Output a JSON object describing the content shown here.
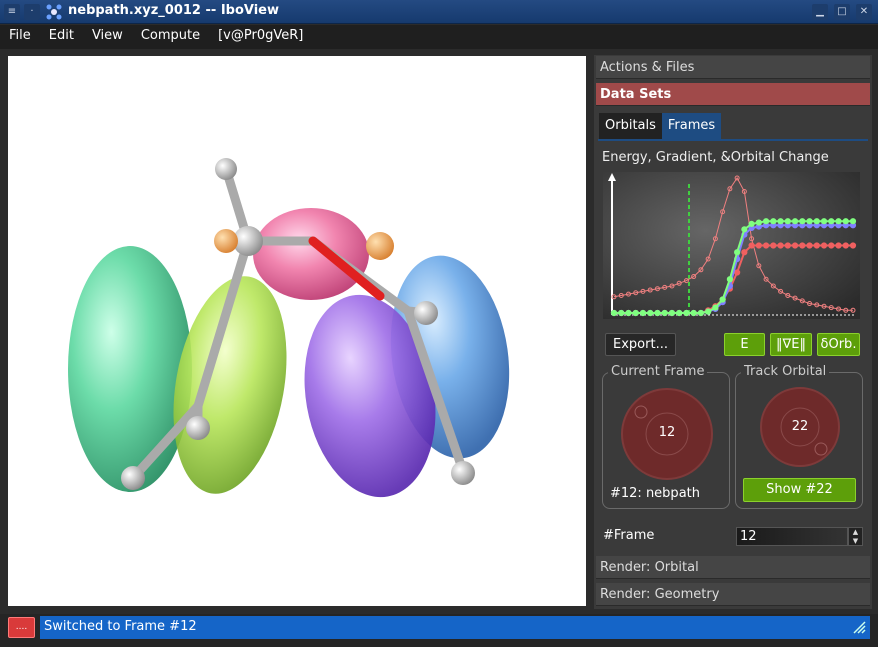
{
  "window": {
    "title": "nebpath.xyz_0012 -- IboView"
  },
  "menu": {
    "items": [
      "File",
      "Edit",
      "View",
      "Compute",
      "[v@Pr0gVeR]"
    ]
  },
  "panel": {
    "sections": {
      "actions": "Actions & Files",
      "datasets": "Data Sets",
      "render_orbital": "Render: Orbital",
      "render_geometry": "Render: Geometry"
    },
    "tabs": [
      "Orbitals",
      "Frames"
    ],
    "plot_title": "Energy, Gradient, &Orbital Change",
    "export_label": "Export...",
    "toggle_e": "E",
    "toggle_grad": "‖∇E‖",
    "toggle_orb": "δOrb.",
    "current_frame": {
      "label": "Current Frame",
      "value": "12",
      "frame_name": "#12: nebpath"
    },
    "track_orbital": {
      "label": "Track Orbital",
      "value": "22",
      "show_label": "Show #22"
    },
    "frame_field": {
      "label": "#Frame",
      "value": "12"
    }
  },
  "status": {
    "indicator": "....",
    "message": "Switched to Frame #12"
  },
  "colors": {
    "accent": "#1565c8",
    "active_section": "#a04a4a",
    "toggle_green": "#5d9f0a"
  },
  "chart_data": {
    "type": "line",
    "title": "",
    "current_frame_marker": 12,
    "series": [
      {
        "color": "#f08080",
        "values": [
          0.12,
          0.13,
          0.14,
          0.15,
          0.16,
          0.17,
          0.18,
          0.19,
          0.2,
          0.22,
          0.24,
          0.27,
          0.32,
          0.4,
          0.55,
          0.75,
          0.92,
          1.0,
          0.9,
          0.55,
          0.35,
          0.25,
          0.2,
          0.16,
          0.13,
          0.11,
          0.09,
          0.07,
          0.06,
          0.05,
          0.04,
          0.03,
          0.02,
          0.02
        ]
      },
      {
        "color": "#f06060",
        "values": [
          0.0,
          0.0,
          0.0,
          0.0,
          0.0,
          0.0,
          0.0,
          0.0,
          0.0,
          0.0,
          0.0,
          0.0,
          0.0,
          0.02,
          0.05,
          0.1,
          0.18,
          0.3,
          0.45,
          0.5,
          0.5,
          0.5,
          0.5,
          0.5,
          0.5,
          0.5,
          0.5,
          0.5,
          0.5,
          0.5,
          0.5,
          0.5,
          0.5,
          0.5
        ]
      },
      {
        "color": "#8080ff",
        "values": [
          0.0,
          0.0,
          0.0,
          0.0,
          0.0,
          0.0,
          0.0,
          0.0,
          0.0,
          0.0,
          0.0,
          0.0,
          0.0,
          0.01,
          0.03,
          0.08,
          0.2,
          0.4,
          0.58,
          0.63,
          0.64,
          0.65,
          0.65,
          0.65,
          0.65,
          0.65,
          0.65,
          0.65,
          0.65,
          0.65,
          0.65,
          0.65,
          0.65,
          0.65
        ]
      },
      {
        "color": "#80ff80",
        "values": [
          0.0,
          0.0,
          0.0,
          0.0,
          0.0,
          0.0,
          0.0,
          0.0,
          0.0,
          0.0,
          0.0,
          0.0,
          0.0,
          0.01,
          0.04,
          0.1,
          0.25,
          0.45,
          0.62,
          0.66,
          0.67,
          0.68,
          0.68,
          0.68,
          0.68,
          0.68,
          0.68,
          0.68,
          0.68,
          0.68,
          0.68,
          0.68,
          0.68,
          0.68
        ]
      }
    ]
  }
}
